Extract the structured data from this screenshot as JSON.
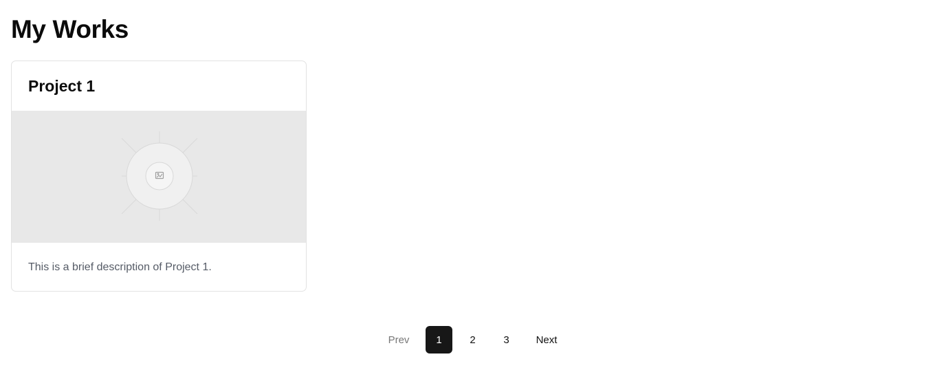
{
  "page": {
    "title": "My Works"
  },
  "projects": [
    {
      "title": "Project 1",
      "description": "This is a brief description of Project 1.",
      "image_icon": "image-placeholder-icon"
    }
  ],
  "pagination": {
    "prev_label": "Prev",
    "pages": [
      "1",
      "2",
      "3"
    ],
    "current_page": "1",
    "next_label": "Next"
  },
  "colors": {
    "background": "#ffffff",
    "text": "#111111",
    "muted_text": "#555b66",
    "card_border": "#e2e2e2",
    "image_placeholder": "#e8e8e8",
    "active_page": "#171717"
  }
}
